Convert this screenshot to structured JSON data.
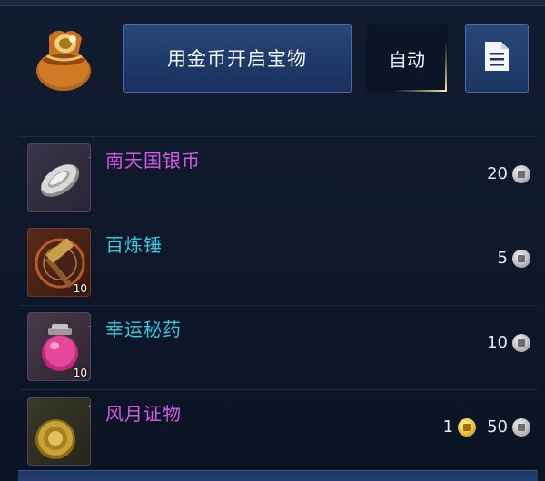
{
  "header": {
    "open_button_label": "用金币开启宝物",
    "auto_button_label": "自动"
  },
  "items": [
    {
      "name": "南天国银币",
      "name_color": "purple",
      "quantity": "",
      "price_gold": "",
      "price_silver": "20"
    },
    {
      "name": "百炼锤",
      "name_color": "cyan",
      "quantity": "10",
      "price_gold": "",
      "price_silver": "5"
    },
    {
      "name": "幸运秘药",
      "name_color": "cyan",
      "quantity": "10",
      "price_gold": "",
      "price_silver": "10"
    },
    {
      "name": "风月证物",
      "name_color": "purple",
      "quantity": "",
      "price_gold": "1",
      "price_silver": "50"
    }
  ],
  "colors": {
    "purple_name": "#d45ae6",
    "cyan_name": "#36c9e0",
    "button_blue": "#1e3868",
    "background": "#0a1222"
  },
  "icons": {
    "bag": "treasure-bag-icon",
    "document": "document-icon",
    "silver_coin": "silver-coin-icon",
    "gold_coin": "gold-coin-icon"
  }
}
